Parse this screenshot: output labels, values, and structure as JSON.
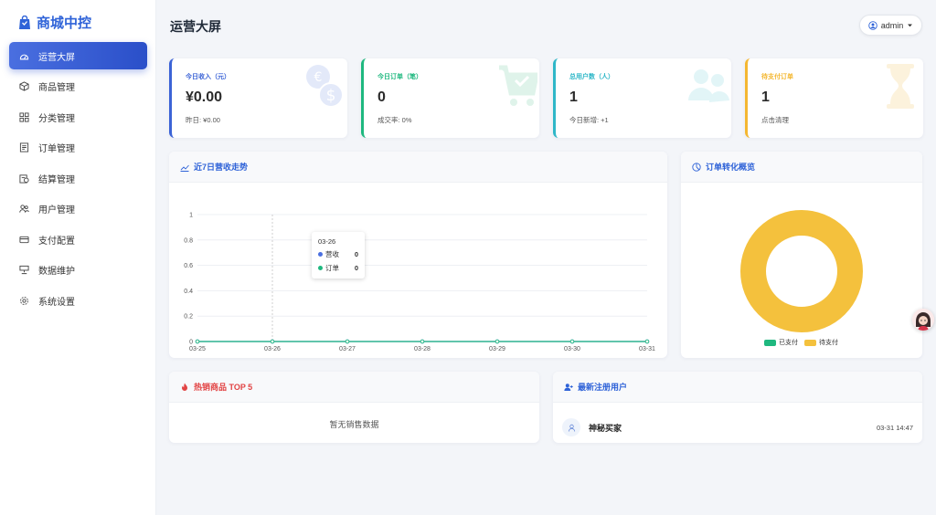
{
  "brand": {
    "name": "商城中控",
    "color": "#2f63d8"
  },
  "sidebar": {
    "items": [
      {
        "label": "运营大屏",
        "icon": "dashboard-icon",
        "active": true
      },
      {
        "label": "商品管理",
        "icon": "box-icon"
      },
      {
        "label": "分类管理",
        "icon": "grid-icon"
      },
      {
        "label": "订单管理",
        "icon": "receipt-icon"
      },
      {
        "label": "结算管理",
        "icon": "settlement-icon"
      },
      {
        "label": "用户管理",
        "icon": "users-icon"
      },
      {
        "label": "支付配置",
        "icon": "credit-card-icon"
      },
      {
        "label": "数据维护",
        "icon": "database-icon"
      },
      {
        "label": "系统设置",
        "icon": "gear-icon"
      }
    ]
  },
  "header": {
    "title": "运营大屏",
    "user": "admin"
  },
  "stats": [
    {
      "label": "今日收入（元）",
      "value": "¥0.00",
      "sub": "昨日: ¥0.00",
      "color": "#3b63d6",
      "icon": "coins-icon"
    },
    {
      "label": "今日订单（笔）",
      "value": "0",
      "sub": "成交率: 0%",
      "color": "#1fb87f",
      "icon": "cart-icon"
    },
    {
      "label": "总用户数（人）",
      "value": "1",
      "sub": "今日新增: +1",
      "color": "#2fb7c8",
      "icon": "users-icon"
    },
    {
      "label": "待支付订单",
      "value": "1",
      "sub": "点击清理",
      "color": "#f4b731",
      "icon": "hourglass-icon"
    }
  ],
  "revenue_panel": {
    "title": "近7日营收走势",
    "icon": "line-chart-icon"
  },
  "conversion_panel": {
    "title": "订单转化概览",
    "icon": "pie-chart-icon"
  },
  "hot_panel": {
    "title": "热销商品 TOP 5",
    "icon": "fire-icon",
    "empty": "暂无销售数据"
  },
  "users_panel": {
    "title": "最新注册用户",
    "icon": "user-plus-icon",
    "users": [
      {
        "name": "神秘买家",
        "time": "03-31 14:47"
      }
    ]
  },
  "tooltip": {
    "date": "03-26",
    "rows": [
      {
        "label": "营收",
        "value": "0",
        "color": "#4a6fe0"
      },
      {
        "label": "订单",
        "value": "0",
        "color": "#1fb87f"
      }
    ]
  },
  "chart_data": [
    {
      "type": "line",
      "x": [
        "03-25",
        "03-26",
        "03-27",
        "03-28",
        "03-29",
        "03-30",
        "03-31"
      ],
      "series": [
        {
          "name": "营收",
          "values": [
            0,
            0,
            0,
            0,
            0,
            0,
            0
          ],
          "color": "#4a6fe0"
        },
        {
          "name": "订单",
          "values": [
            0,
            0,
            0,
            0,
            0,
            0,
            0
          ],
          "color": "#1fb87f"
        }
      ],
      "ylim": [
        0,
        1
      ],
      "yticks": [
        "0",
        "0.2",
        "0.4",
        "0.6",
        "0.8",
        "1"
      ],
      "grid": true
    },
    {
      "type": "pie",
      "donut": true,
      "categories": [
        "已支付",
        "待支付"
      ],
      "values": [
        0,
        1
      ],
      "colors": [
        "#1fb87f",
        "#f4c13d"
      ],
      "legend": "bottom"
    }
  ]
}
